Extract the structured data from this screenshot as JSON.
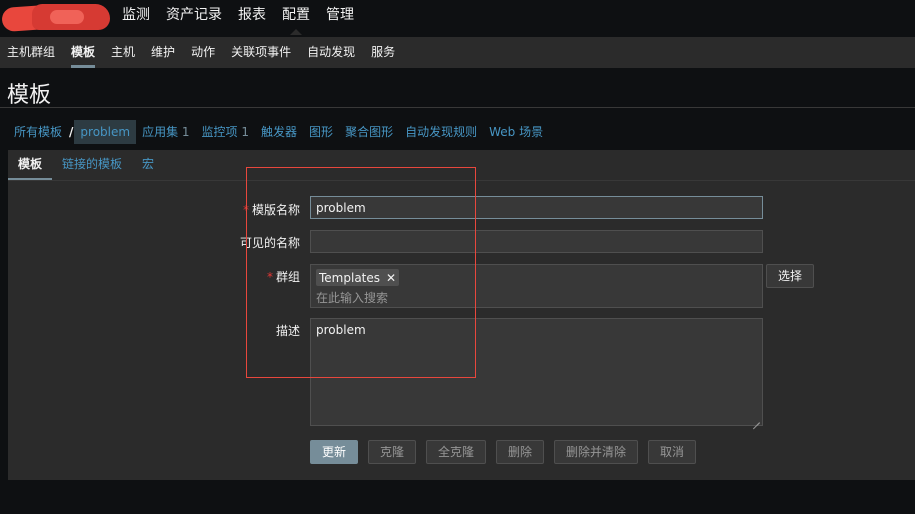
{
  "main_nav": [
    "监测",
    "资产记录",
    "报表",
    "配置",
    "管理"
  ],
  "sub_nav": [
    "主机群组",
    "模板",
    "主机",
    "维护",
    "动作",
    "关联项事件",
    "自动发现",
    "服务"
  ],
  "page": {
    "title": "模板"
  },
  "breadcrumbs": {
    "all_templates": "所有模板",
    "separator": "/",
    "current": "problem",
    "applications": "应用集",
    "applications_count": "1",
    "items": "监控项",
    "items_count": "1",
    "triggers": "触发器",
    "graphs": "图形",
    "screens": "聚合图形",
    "discovery": "自动发现规则",
    "web": "Web 场景"
  },
  "tabs": [
    "模板",
    "链接的模板",
    "宏"
  ],
  "form": {
    "required_mark": "*",
    "name_label": "模版名称",
    "name_value": "problem",
    "visible_name_label": "可见的名称",
    "visible_name_value": "",
    "groups_label": "群组",
    "group_tag": "Templates",
    "group_tag_remove": "✕",
    "groups_placeholder": "在此输入搜索",
    "select_button": "选择",
    "description_label": "描述",
    "description_value": "problem"
  },
  "actions": {
    "update": "更新",
    "clone": "克隆",
    "full_clone": "全克隆",
    "delete": "删除",
    "delete_and_clear": "删除并清除",
    "cancel": "取消"
  },
  "colors": {
    "accent": "#768d99",
    "link": "#4796c4",
    "required": "#e33734",
    "annotation_box": "#e8473d"
  }
}
